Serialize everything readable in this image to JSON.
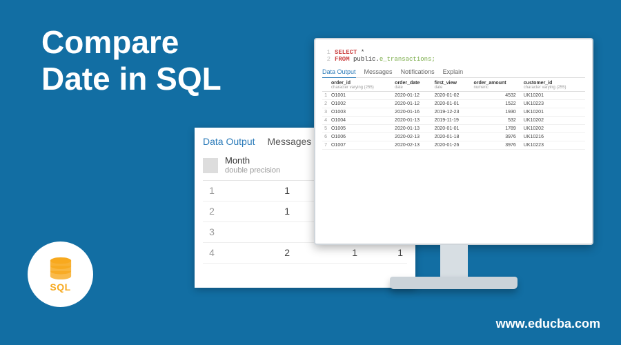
{
  "title_line1": "Compare",
  "title_line2": "Date in SQL",
  "logo_text": "SQL",
  "url": "www.educba.com",
  "back": {
    "tab1": "Data Output",
    "tab2": "Messages",
    "col_label": "Month",
    "col_type": "double precision",
    "rows": [
      {
        "i": "1",
        "v": "1",
        "a": "",
        "b": ""
      },
      {
        "i": "2",
        "v": "1",
        "a": "",
        "b": ""
      },
      {
        "i": "3",
        "v": "",
        "a": "",
        "b": ""
      },
      {
        "i": "4",
        "v": "2",
        "a": "1",
        "b": "1"
      }
    ]
  },
  "code": {
    "l1": "SELECT",
    "l1b": "*",
    "l2": "FROM",
    "l2b": "public.",
    "l2c": "e_transactions;"
  },
  "res": {
    "t1": "Data Output",
    "t2": "Messages",
    "t3": "Notifications",
    "t4": "Explain",
    "h1": "order_id",
    "h1s": "character varying (255)",
    "h2": "order_date",
    "h2s": "date",
    "h3": "first_view",
    "h3s": "date",
    "h4": "order_amount",
    "h4s": "numeric",
    "h5": "customer_id",
    "h5s": "character varying (255)",
    "rows": [
      {
        "i": "1",
        "a": "O1001",
        "b": "2020-01-12",
        "c": "2020-01-02",
        "d": "4532",
        "e": "UK10201"
      },
      {
        "i": "2",
        "a": "O1002",
        "b": "2020-01-12",
        "c": "2020-01-01",
        "d": "1522",
        "e": "UK10223"
      },
      {
        "i": "3",
        "a": "O1003",
        "b": "2020-01-16",
        "c": "2019-12-23",
        "d": "1930",
        "e": "UK10201"
      },
      {
        "i": "4",
        "a": "O1004",
        "b": "2020-01-13",
        "c": "2019-11-19",
        "d": "532",
        "e": "UK10202"
      },
      {
        "i": "5",
        "a": "O1005",
        "b": "2020-01-13",
        "c": "2020-01-01",
        "d": "1789",
        "e": "UK10202"
      },
      {
        "i": "6",
        "a": "O1006",
        "b": "2020-02-13",
        "c": "2020-01-18",
        "d": "3976",
        "e": "UK10216"
      },
      {
        "i": "7",
        "a": "O1007",
        "b": "2020-02-13",
        "c": "2020-01-26",
        "d": "3976",
        "e": "UK10223"
      }
    ]
  }
}
